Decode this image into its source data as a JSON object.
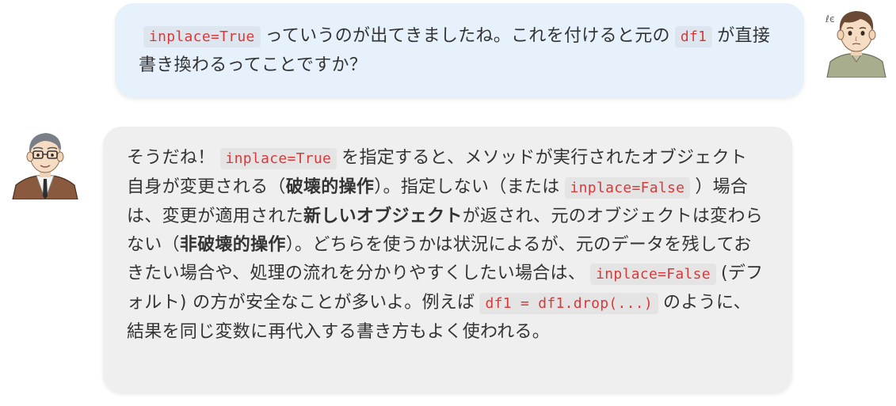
{
  "messages": {
    "user": {
      "seg1": "inplace=True",
      "seg2": "っていうのが出てきましたね。これを付けると元の",
      "seg3": "df1",
      "seg4": "が直接書き換わるってことですか？"
    },
    "ai": {
      "s1": "そうだね！",
      "c1": "inplace=True",
      "s2": "を指定すると、メソッドが実行されたオブジェクト自身が変更される（",
      "b1": "破壊的操作",
      "s3": "）。指定しない（または",
      "c2": "inplace=False",
      "s4": "）場合は、変更が適用された",
      "b2": "新しいオブジェクト",
      "s5": "が返され、元のオブジェクトは変わらない（",
      "b3": "非破壊的操作",
      "s6": "）。どちらを使うかは状況によるが、元のデータを残しておきたい場合や、処理の流れを分かりやすくしたい場合は、",
      "c3": "inplace=False",
      "s7": "(デフォルト) の方が安全なことが多いよ。例えば",
      "c4": "df1 = df1.drop(...)",
      "s8": "のように、結果を同じ変数に再代入する書き方もよく使われる。"
    }
  },
  "avatars": {
    "user": "young-man-avatar",
    "ai": "glasses-man-avatar"
  },
  "colors": {
    "user_bubble": "#e6f1fb",
    "ai_bubble": "#efefef",
    "code_text": "#d83a3a"
  }
}
